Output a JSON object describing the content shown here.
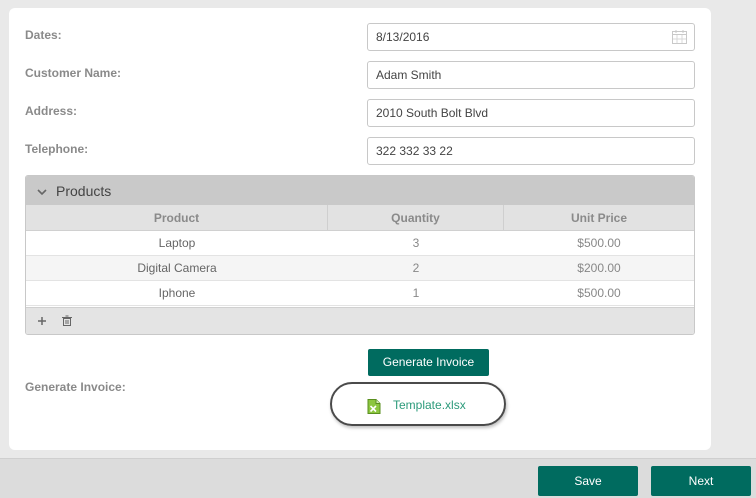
{
  "form": {
    "dates": {
      "label": "Dates:",
      "value": "8/13/2016"
    },
    "customer_name": {
      "label": "Customer Name:",
      "value": "Adam Smith"
    },
    "address": {
      "label": "Address:",
      "value": "2010 South Bolt Blvd"
    },
    "telephone": {
      "label": "Telephone:",
      "value": "322 332 33 22"
    }
  },
  "products": {
    "title": "Products",
    "columns": [
      "Product",
      "Quantity",
      "Unit Price"
    ],
    "rows": [
      {
        "product": "Laptop",
        "quantity": "3",
        "unit_price": "$500.00"
      },
      {
        "product": "Digital Camera",
        "quantity": "2",
        "unit_price": "$200.00"
      },
      {
        "product": "Iphone",
        "quantity": "1",
        "unit_price": "$500.00"
      }
    ]
  },
  "generate": {
    "label": "Generate Invoice:",
    "button_label": "Generate Invoice",
    "file_name": "Template.xlsx"
  },
  "footer": {
    "save_label": "Save",
    "next_label": "Next"
  },
  "colors": {
    "accent": "#006b5f",
    "link": "#2b9a7a",
    "page_bg": "#e9e9e9"
  },
  "icons": {
    "calendar": "calendar-icon",
    "collapse": "chevron-down-icon",
    "add": "plus-icon",
    "delete": "trash-icon",
    "file": "excel-file-icon"
  }
}
